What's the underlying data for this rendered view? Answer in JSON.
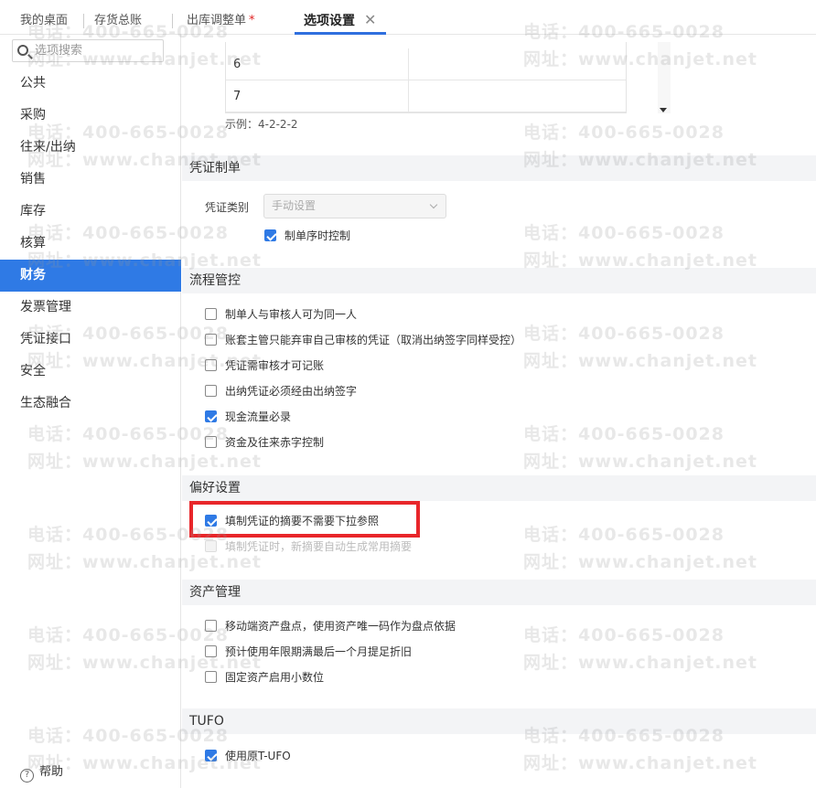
{
  "tabs": [
    {
      "label": "我的桌面"
    },
    {
      "label": "存货总账"
    },
    {
      "label": "出库调整单",
      "modified": true,
      "marker": "*"
    },
    {
      "label": "选项设置",
      "active": true
    }
  ],
  "sidebar": {
    "search_placeholder": "选项搜索",
    "items": [
      {
        "label": "公共"
      },
      {
        "label": "采购"
      },
      {
        "label": "往来/出纳"
      },
      {
        "label": "销售"
      },
      {
        "label": "库存"
      },
      {
        "label": "核算"
      },
      {
        "label": "财务",
        "active": true
      },
      {
        "label": "发票管理"
      },
      {
        "label": "凭证接口"
      },
      {
        "label": "安全"
      },
      {
        "label": "生态融合"
      }
    ],
    "help_label": "帮助",
    "help_icon": "question-circle-icon"
  },
  "grid": {
    "rows": [
      "6",
      "7"
    ],
    "example": "示例：4-2-2-2"
  },
  "sections": {
    "voucher": {
      "title": "凭证制单",
      "type_label": "凭证类别",
      "type_value": "手动设置",
      "options": [
        {
          "label": "制单序时控制",
          "checked": true
        }
      ]
    },
    "process": {
      "title": "流程管控",
      "options": [
        {
          "label": "制单人与审核人可为同一人",
          "checked": false
        },
        {
          "label": "账套主管只能弃审自己审核的凭证（取消出纳签字同样受控）",
          "checked": false
        },
        {
          "label": "凭证需审核才可记账",
          "checked": false
        },
        {
          "label": "出纳凭证必须经由出纳签字",
          "checked": false
        },
        {
          "label": "现金流量必录",
          "checked": true
        },
        {
          "label": "资金及往来赤字控制",
          "checked": false
        }
      ]
    },
    "preference": {
      "title": "偏好设置",
      "options": [
        {
          "label": "填制凭证的摘要不需要下拉参照",
          "checked": true
        },
        {
          "label": "填制凭证时，新摘要自动生成常用摘要",
          "checked": false,
          "disabled": true
        }
      ]
    },
    "assets": {
      "title": "资产管理",
      "options": [
        {
          "label": "移动端资产盘点，使用资产唯一码作为盘点依据",
          "checked": false
        },
        {
          "label": "预计使用年限期满最后一个月提足折旧",
          "checked": false
        },
        {
          "label": "固定资产启用小数位",
          "checked": false
        }
      ]
    },
    "tufo": {
      "title": "TUFO",
      "options": [
        {
          "label": "使用原T-UFO",
          "checked": true
        }
      ]
    }
  },
  "watermark": {
    "phone": "电话：400-665-0028",
    "site": "网址：www.chanjet.net"
  },
  "colors": {
    "accent": "#2f7ae5",
    "highlight_border": "#e8262a"
  }
}
